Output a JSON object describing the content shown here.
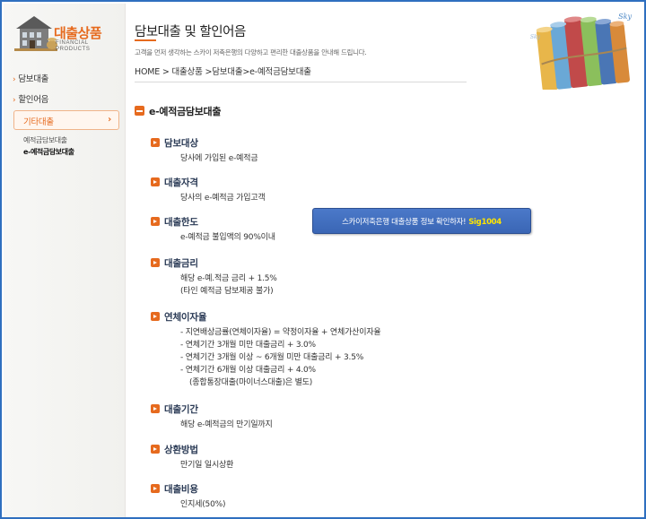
{
  "logo": {
    "title": "대출상품",
    "subtitle": "FINANCIAL PRODUCTS"
  },
  "sidebar": {
    "items": [
      {
        "label": "담보대출"
      },
      {
        "label": "할인어음"
      },
      {
        "label": "기타대출"
      }
    ],
    "sub_items": [
      {
        "label": "예적금담보대출"
      },
      {
        "label": "e-예적금담보대출"
      }
    ]
  },
  "header": {
    "title": "담보대출 및 할인어음",
    "description": "고객을 먼저 생각하는 스카이 저축은행의 다양하고 편리한 대출상품을 안내해 드립니다.",
    "deco_label": "Sky",
    "breadcrumb": [
      "HOME",
      ">",
      "대출상품",
      ">담보대출>e-예적금담보대출"
    ]
  },
  "main": {
    "section_title": "e-예적금담보대출",
    "items": [
      {
        "heading": "담보대상",
        "lines": [
          "당사에 가입된 e-예적금"
        ]
      },
      {
        "heading": "대출자격",
        "lines": [
          "당사의 e-예적금 가입고객"
        ]
      },
      {
        "heading": "대출한도",
        "lines": [
          "e-예적금 불입액의 90%이내"
        ]
      },
      {
        "heading": "대출금리",
        "lines": [
          "해당 e-예.적금 금리 + 1.5%",
          "(타인 예적금 담보제공 불가)"
        ]
      },
      {
        "heading": "연체이자율",
        "lines": [
          "- 지연배상금률(연체이자율) = 약정이자율 + 연체가산이자율",
          "- 연체기간 3개월 미만 대출금리 + 3.0%",
          "- 연체기간 3개월 이상 ~ 6개월 미만 대출금리 + 3.5%",
          "- 연체기간 6개월 이상 대출금리 + 4.0%",
          "(종합통장대출(마이너스대출)은 별도)"
        ]
      },
      {
        "heading": "대출기간",
        "lines": [
          "해당 e-예적금의 만기일까지"
        ]
      },
      {
        "heading": "상환방법",
        "lines": [
          "만기일 일시상환"
        ]
      },
      {
        "heading": "대출비용",
        "lines": [
          "인지세(50%)"
        ]
      }
    ]
  },
  "banner": {
    "text": "스카이저축은행 대출상품 정보 확인하자!",
    "tag": "Sig1004"
  },
  "colors": {
    "accent": "#e66a1e",
    "frame": "#2f6fbf",
    "banner": "#3a66b5"
  }
}
